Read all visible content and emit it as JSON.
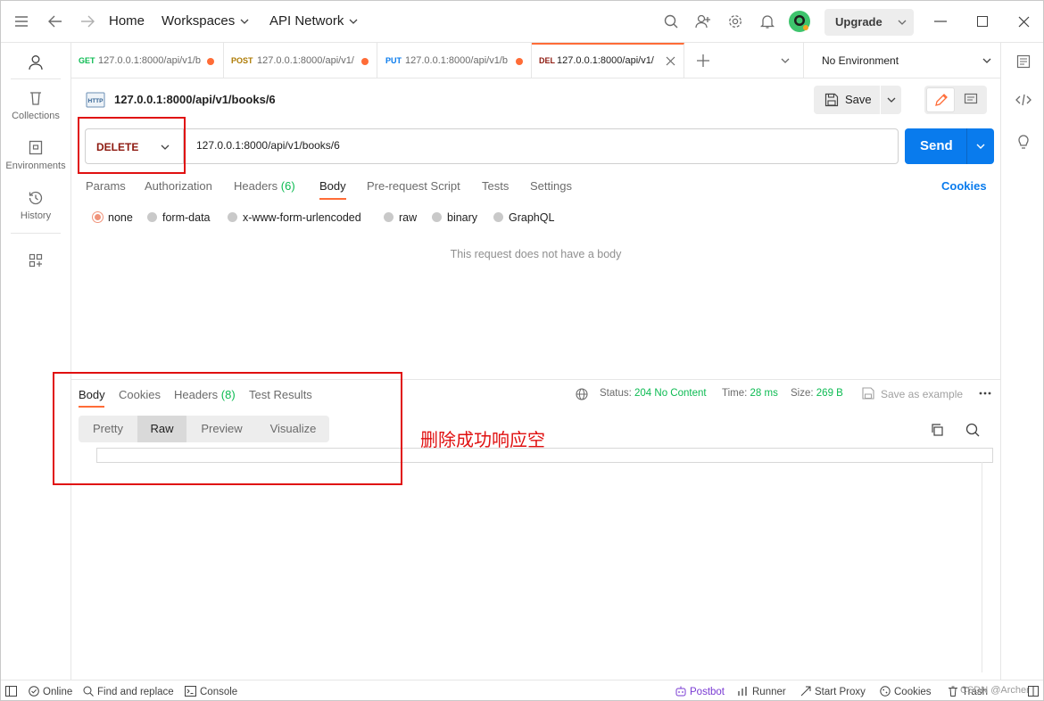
{
  "topbar": {
    "home": "Home",
    "workspaces": "Workspaces",
    "api_network": "API Network",
    "upgrade": "Upgrade"
  },
  "sidebar": {
    "items": [
      {
        "label": "Collections",
        "icon": "trash-can-icon"
      },
      {
        "label": "Environments",
        "icon": "environment-icon"
      },
      {
        "label": "History",
        "icon": "history-icon"
      }
    ]
  },
  "tabs": [
    {
      "method": "GET",
      "method_color": "#0cbb52",
      "url": "127.0.0.1:8000/api/v1/b"
    },
    {
      "method": "POST",
      "method_color": "#ad7a03",
      "url": "127.0.0.1:8000/api/v1/"
    },
    {
      "method": "PUT",
      "method_color": "#097bed",
      "url": "127.0.0.1:8000/api/v1/b"
    },
    {
      "method": "DEL",
      "method_color": "#8e1a10",
      "url": "127.0.0.1:8000/api/v1/"
    }
  ],
  "environment": "No Environment",
  "request": {
    "name": "127.0.0.1:8000/api/v1/books/6",
    "save_label": "Save",
    "method": "DELETE",
    "url": "127.0.0.1:8000/api/v1/books/6",
    "send_label": "Send",
    "subtabs": {
      "params": "Params",
      "authorization": "Authorization",
      "headers": "Headers",
      "headers_count": "(6)",
      "body": "Body",
      "prerequest": "Pre-request Script",
      "tests": "Tests",
      "settings": "Settings",
      "cookies": "Cookies"
    },
    "body_types": [
      "none",
      "form-data",
      "x-www-form-urlencoded",
      "raw",
      "binary",
      "GraphQL"
    ],
    "body_selected": "none",
    "no_body_text": "This request does not have a body"
  },
  "response": {
    "tabs": {
      "body": "Body",
      "cookies": "Cookies",
      "headers": "Headers",
      "headers_count": "(8)",
      "test_results": "Test Results"
    },
    "status_label": "Status:",
    "status_value": "204 No Content",
    "time_label": "Time:",
    "time_value": "28 ms",
    "size_label": "Size:",
    "size_value": "269 B",
    "save_example": "Save as example",
    "views": [
      "Pretty",
      "Raw",
      "Preview",
      "Visualize"
    ],
    "view_selected": "Raw"
  },
  "annotation": "删除成功响应空",
  "footer": {
    "online": "Online",
    "find_replace": "Find and replace",
    "console": "Console",
    "postbot": "Postbot",
    "runner": "Runner",
    "start_proxy": "Start Proxy",
    "cookies": "Cookies",
    "trash": "Trash",
    "watermark": "CSDN @Archer"
  },
  "colors": {
    "accent": "#ff6c37",
    "send_blue": "#097bed",
    "success_green": "#0cbb52",
    "delete_red": "#8e1a10",
    "annotation_red": "#e01010"
  }
}
